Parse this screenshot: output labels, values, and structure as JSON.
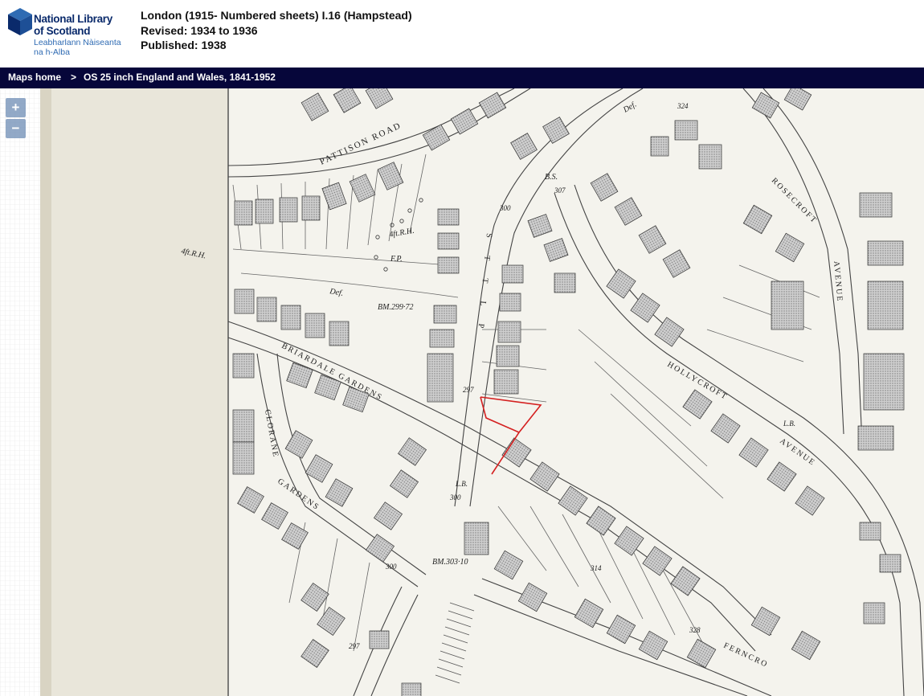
{
  "logo": {
    "line1": "National Library",
    "line2": "of Scotland",
    "gaelic1": "Leabharlann Nàiseanta",
    "gaelic2": "na h-Alba"
  },
  "sheet": {
    "title": "London (1915- Numbered sheets) I.16 (Hampstead)",
    "revised": "Revised: 1934 to 1936",
    "published": "Published: 1938"
  },
  "breadcrumb": {
    "home": "Maps home",
    "separator": ">",
    "series": "OS 25 inch England and Wales, 1841-1952"
  },
  "zoom": {
    "in_label": "+",
    "out_label": "−"
  },
  "map_labels": {
    "pattison": "PATTISON ROAD",
    "briardale": "BRIARDALE GARDENS",
    "clorane": "CLORANE",
    "gardens": "GARDENS",
    "hollycroft": "HOLLYCROFT",
    "avenue": "AVENUE",
    "rosecroft": "ROSECROFT",
    "avenue2": "AVENUE",
    "fernc": "FERNCRO",
    "bm1": "BM.299·72",
    "bm2": "BM.303·10",
    "n324": "324",
    "n307": "307",
    "n300a": "300",
    "n297a": "297",
    "n300b": "300",
    "n300c": "300",
    "n314": "314",
    "n328": "328",
    "n297b": "297",
    "rh1": "4ft.R.H.",
    "rh2": "4ft.R.H.",
    "fp": "F.P.",
    "def1": "Def.",
    "def2": "Def.",
    "bs": "B.S.",
    "lb1": "L.B.",
    "lb2": "L.B.",
    "road_letters": "S T T L P"
  },
  "colors": {
    "header_bar": "#06063a",
    "logo_text": "#0a2a6b",
    "logo_gaelic": "#2f6bb3",
    "paper": "#f4f3ed",
    "margin": "#e9e6da",
    "ink": "#333333",
    "boundary": "#d42020"
  }
}
